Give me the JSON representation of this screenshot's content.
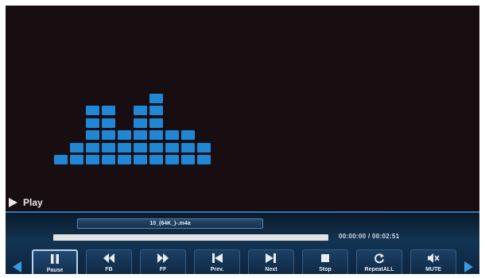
{
  "player": {
    "status_text": "Play",
    "file_name": "10_(64K_)-.m4a",
    "time_display": "00:00:00 / 00:02:51",
    "progress": 0.0
  },
  "visualizer": {
    "bar_levels": [
      1,
      2,
      5,
      5,
      3,
      5,
      6,
      3,
      3,
      2
    ]
  },
  "controls": [
    {
      "label": "Pause",
      "icon": "pause-icon",
      "selected": true
    },
    {
      "label": "FB",
      "icon": "fast-backward-icon",
      "selected": false
    },
    {
      "label": "FF",
      "icon": "fast-forward-icon",
      "selected": false
    },
    {
      "label": "Prev.",
      "icon": "previous-icon",
      "selected": false
    },
    {
      "label": "Next",
      "icon": "next-icon",
      "selected": false
    },
    {
      "label": "Stop",
      "icon": "stop-icon",
      "selected": false
    },
    {
      "label": "RepeatALL",
      "icon": "repeat-icon",
      "selected": false
    },
    {
      "label": "MUTE",
      "icon": "mute-icon",
      "selected": false
    }
  ],
  "colors": {
    "screen_background": "#180d10",
    "visualizer_block": "#1f87d6",
    "panel_accent": "#2b79b8",
    "arrow": "#3a9ae0"
  }
}
